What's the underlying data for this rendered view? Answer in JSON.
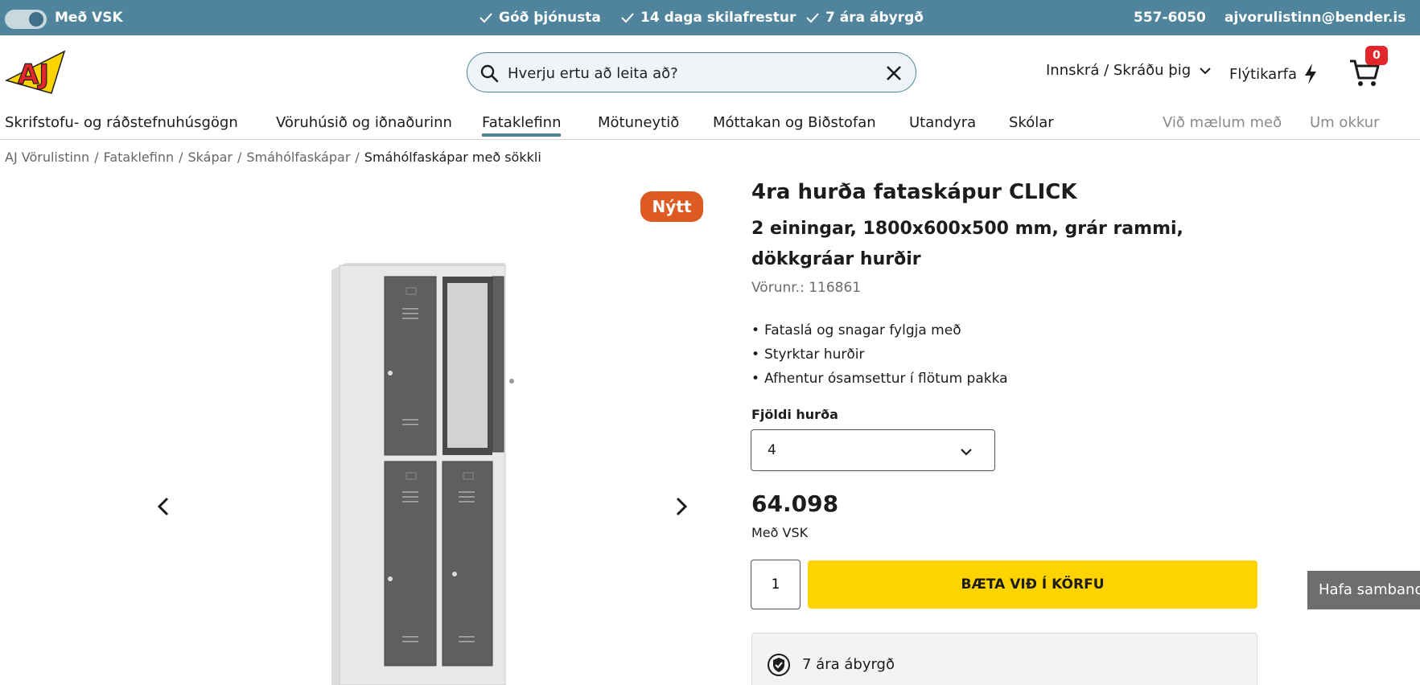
{
  "topbar": {
    "vat_toggle_label": "Með VSK",
    "vat_toggle_on": true,
    "usps": [
      "Góð þjónusta",
      "14 daga skilafrestur",
      "7 ára ábyrgð"
    ],
    "phone": "557-6050",
    "email": "ajvorulistinn@bender.is",
    "background_color": "#4f849c"
  },
  "header": {
    "logo_text": "AJ",
    "search_placeholder": "Hverju ertu að leita að?",
    "login_label": "Innskrá / Skráðu þig",
    "quick_cart_label": "Flýtikarfa",
    "cart_count": "0"
  },
  "nav": {
    "items": [
      "Skrifstofu- og ráðstefnuhúsgögn",
      "Vöruhúsið og iðnaðurinn",
      "Fataklefinn",
      "Mötuneytið",
      "Móttakan og Biðstofan",
      "Utandyra",
      "Skólar"
    ],
    "active_index": 2,
    "secondary": [
      "Við mælum með",
      "Um okkur"
    ]
  },
  "breadcrumb": {
    "links": [
      "AJ Vörulistinn",
      "Fataklefinn",
      "Skápar",
      "Smáhólfaskápar"
    ],
    "current": "Smáhólfaskápar með sökkli"
  },
  "gallery": {
    "badge": "Nýtt",
    "badge_color": "#dd5a22"
  },
  "product": {
    "title": "4ra hurða fataskápur CLICK",
    "subtitle": "2 einingar, 1800x600x500 mm, grár rammi, dökkgráar hurðir",
    "sku": "Vörunr.: 116861",
    "bullets": [
      "Fataslá og snagar fylgja með",
      "Styrktar hurðir",
      "Afhentur ósamsettur í flötum pakka"
    ],
    "option_label": "Fjöldi hurða",
    "option_value": "4",
    "price": "64.098",
    "price_note": "Með VSK",
    "quantity": "1",
    "add_to_cart_label": "BÆTA VIÐ Í KÖRFU",
    "add_to_cart_color": "#fed400",
    "warranty": "7 ára ábyrgð"
  },
  "contact_tab": "Hafa samband"
}
